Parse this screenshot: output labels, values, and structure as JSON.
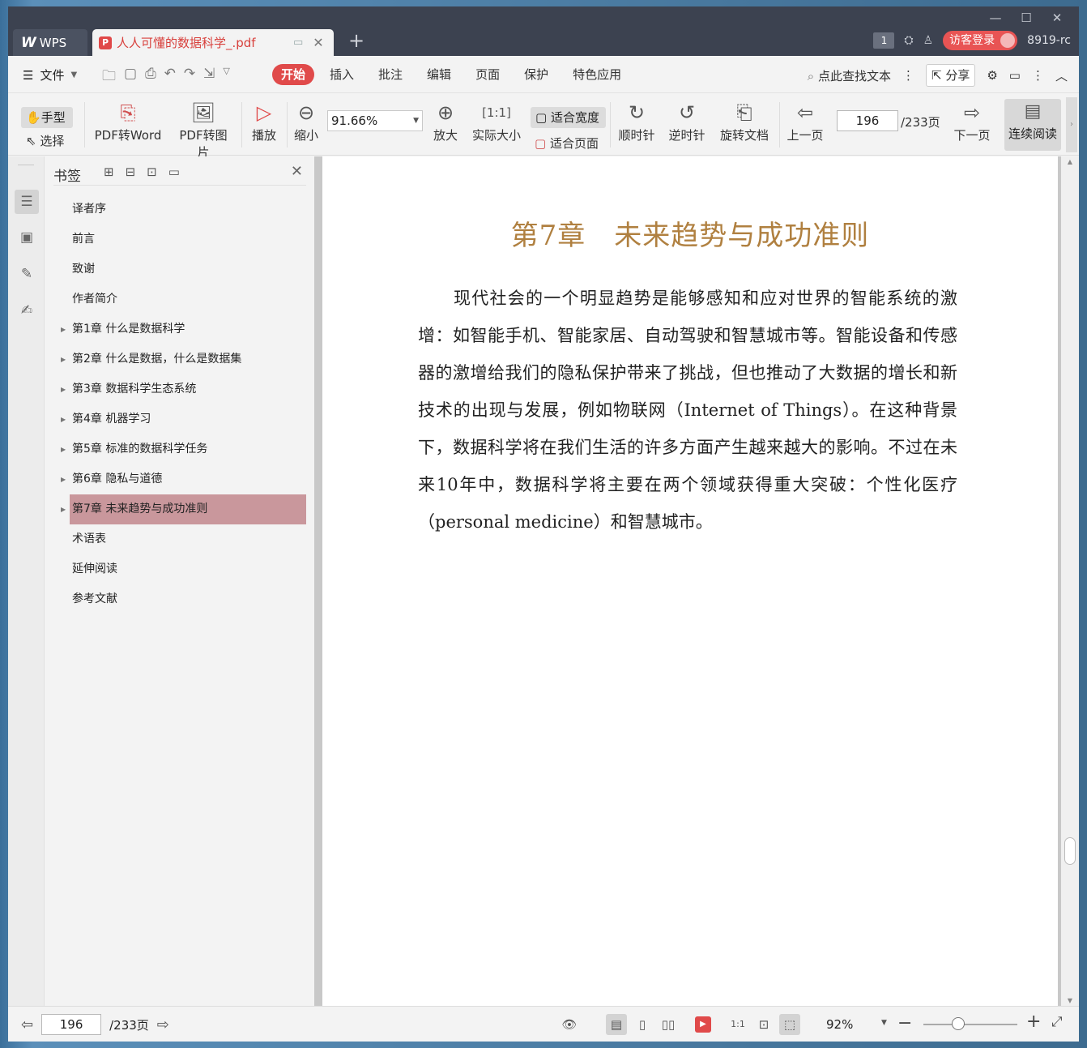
{
  "titlebar": {
    "app_tab": "WPS",
    "app_logo": "W",
    "doc_tab": "人人可懂的数据科学_.pdf",
    "page_badge": "1",
    "login": "访客登录",
    "username": "8919-rc"
  },
  "menubar": {
    "file": "文件",
    "tabs": [
      "开始",
      "插入",
      "批注",
      "编辑",
      "页面",
      "保护",
      "特色应用"
    ],
    "search": "点此查找文本",
    "share": "分享"
  },
  "ribbon": {
    "hand": "手型",
    "select": "选择",
    "pdf_to_word": "PDF转Word",
    "pdf_to_image": "PDF转图片",
    "play": "播放",
    "zoom_out": "缩小",
    "zoom_value": "91.66%",
    "zoom_in": "放大",
    "actual_size": "实际大小",
    "fit_width": "适合宽度",
    "fit_page": "适合页面",
    "rotate_cw": "顺时针",
    "rotate_ccw": "逆时针",
    "rotate_doc": "旋转文档",
    "prev_page": "上一页",
    "page_current": "196",
    "page_total": "/233页",
    "next_page": "下一页",
    "continuous_read": "连续阅读"
  },
  "bookmarks": {
    "title": "书签",
    "items": [
      {
        "label": "译者序",
        "expandable": false,
        "selected": false
      },
      {
        "label": "前言",
        "expandable": false,
        "selected": false
      },
      {
        "label": "致谢",
        "expandable": false,
        "selected": false
      },
      {
        "label": "作者简介",
        "expandable": false,
        "selected": false
      },
      {
        "label": "第1章 什么是数据科学",
        "expandable": true,
        "selected": false
      },
      {
        "label": "第2章 什么是数据，什么是数据集",
        "expandable": true,
        "selected": false
      },
      {
        "label": "第3章 数据科学生态系统",
        "expandable": true,
        "selected": false
      },
      {
        "label": "第4章 机器学习",
        "expandable": true,
        "selected": false
      },
      {
        "label": "第5章 标准的数据科学任务",
        "expandable": true,
        "selected": false
      },
      {
        "label": "第6章 隐私与道德",
        "expandable": true,
        "selected": false
      },
      {
        "label": "第7章 未来趋势与成功准则",
        "expandable": true,
        "selected": true
      },
      {
        "label": "术语表",
        "expandable": false,
        "selected": false
      },
      {
        "label": "延伸阅读",
        "expandable": false,
        "selected": false
      },
      {
        "label": "参考文献",
        "expandable": false,
        "selected": false
      }
    ]
  },
  "document": {
    "chapter_title": "第7章　未来趋势与成功准则",
    "paragraph": "现代社会的一个明显趋势是能够感知和应对世界的智能系统的激增：如智能手机、智能家居、自动驾驶和智慧城市等。智能设备和传感器的激增给我们的隐私保护带来了挑战，但也推动了大数据的增长和新技术的出现与发展，例如物联网（Internet of Things）。在这种背景下，数据科学将在我们生活的许多方面产生越来越大的影响。不过在未来10年中，数据科学将主要在两个领域获得重大突破：个性化医疗（personal medicine）和智慧城市。"
  },
  "statusbar": {
    "page_current": "196",
    "page_total": "/233页",
    "zoom": "92%",
    "zoom_level": 0.37
  },
  "colors": {
    "accent": "#e04a4a",
    "title_bar": "#3c4250",
    "chapter_title": "#b08040",
    "selected_bookmark": "#c9979c"
  }
}
